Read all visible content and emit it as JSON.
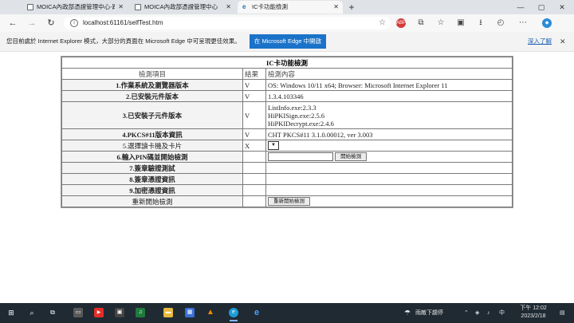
{
  "tabs": [
    {
      "title": "MOICA內政部憑證管理中心-跨平",
      "active": false
    },
    {
      "title": "MOICA內政部憑證管理中心",
      "active": false
    },
    {
      "title": "IC卡功能檢測",
      "active": true
    }
  ],
  "window_controls": {
    "minimize": "—",
    "maximize": "▢",
    "close": "✕"
  },
  "newtab_glyph": "+",
  "address": {
    "url": "localhost:61161/selfTest.htm",
    "info_glyph": "i",
    "star_glyph": "☆"
  },
  "ie_bar": {
    "message": "您目前處於 Internet Explorer 模式，大部分的頁面在 Microsoft Edge 中可呈現更佳效果。",
    "open_button": "在 Microsoft Edge 中開啟",
    "more_link": "深入了解",
    "close_glyph": "✕"
  },
  "test_table": {
    "title": "IC卡功能檢測",
    "headers": [
      "檢測項目",
      "結果",
      "檢測內容"
    ],
    "rows": [
      {
        "item": "1.作業系統及瀏覽器版本",
        "result": "V",
        "content": [
          "OS: Windows 10/11 x64;  Browser: Microsoft Internet Explorer 11"
        ]
      },
      {
        "item": "2.已安裝元件版本",
        "result": "V",
        "content": [
          "1.3.4.103346"
        ]
      },
      {
        "item": "3.已安裝子元件版本",
        "result": "V",
        "content": [
          "ListInfo.exe:2.3.3",
          "HiPKISign.exe:2.5.6",
          "HiPKIDecrypt.exe:2.4.6"
        ]
      },
      {
        "item": "4.PKCS#11版本資訊",
        "result": "V",
        "content": [
          "CHT PKCS#11 3.1.0.00012, ver 3.003"
        ]
      },
      {
        "item": "5.選擇讀卡機及卡片",
        "result": "X",
        "content": []
      },
      {
        "item": "6.輸入PIN碼並開始檢測",
        "result": "",
        "content": []
      },
      {
        "item": "7.簽章驗證測試",
        "result": "",
        "content": []
      },
      {
        "item": "8.簽章憑證資訊",
        "result": "",
        "content": []
      },
      {
        "item": "9.加密憑證資訊",
        "result": "",
        "content": []
      }
    ],
    "start_test_button": "開始檢測",
    "restart_label": "重新開始檢測",
    "restart_button": "重新開始檢測"
  },
  "taskbar": {
    "weather": "雨敵下趨停",
    "time": "下午 12:02",
    "date": "2023/2/18"
  },
  "colors": {
    "accent": "#1a73c8",
    "taskbar": "#1f2a33",
    "tab_strip": "#dfe3e8"
  }
}
